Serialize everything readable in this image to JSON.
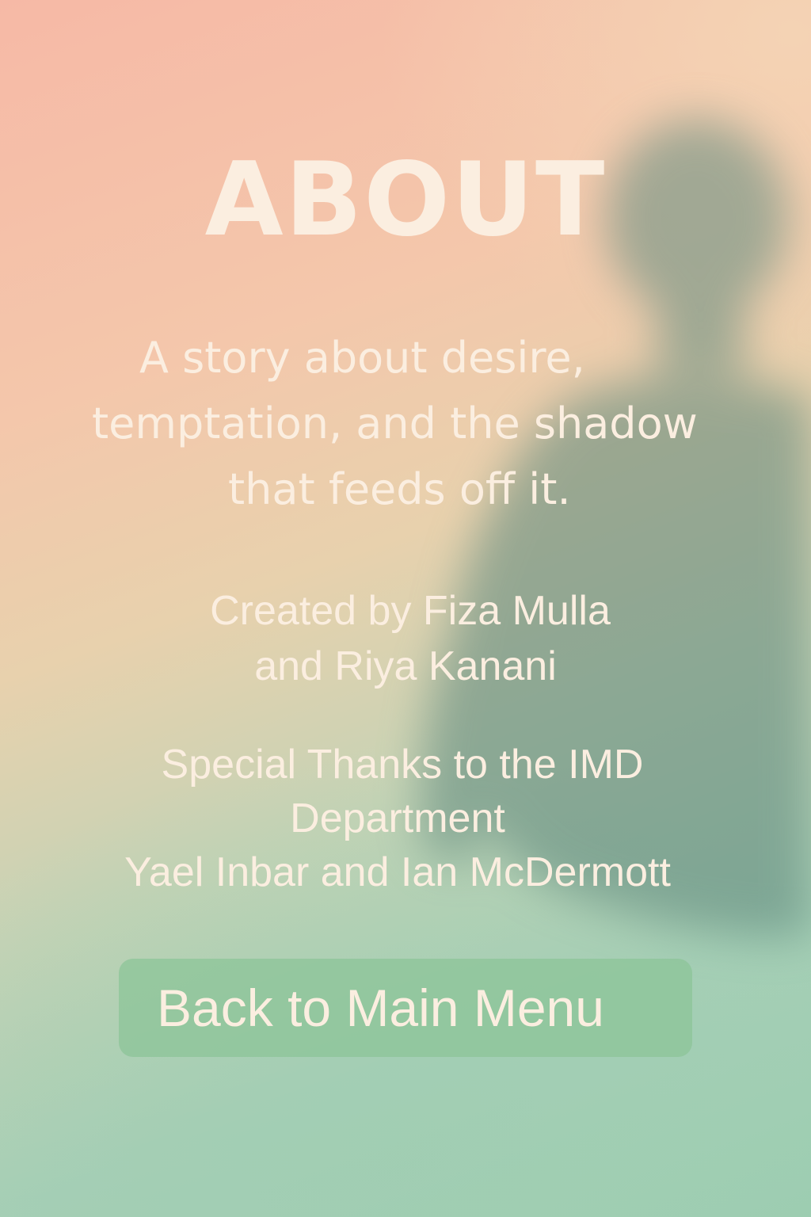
{
  "screen": {
    "title": "ABOUT",
    "tagline": [
      "A story about desire,",
      "temptation, and the shadow",
      "that feeds off it."
    ],
    "credits": [
      "Created by Fiza Mulla",
      "and Riya Kanani"
    ],
    "thanks": [
      "Special Thanks to the IMD",
      "Department",
      "Yael Inbar and Ian McDermott"
    ],
    "back_button_label": "Back to Main Menu"
  },
  "colors": {
    "text": "#fbeee0",
    "background_top": "#f6b9a6",
    "background_bottom": "#9ccdb1",
    "button": "#8cc498",
    "shadow_figure": "#6f9a8c"
  },
  "icons": {
    "background_figure": "shadow-silhouette-icon"
  }
}
